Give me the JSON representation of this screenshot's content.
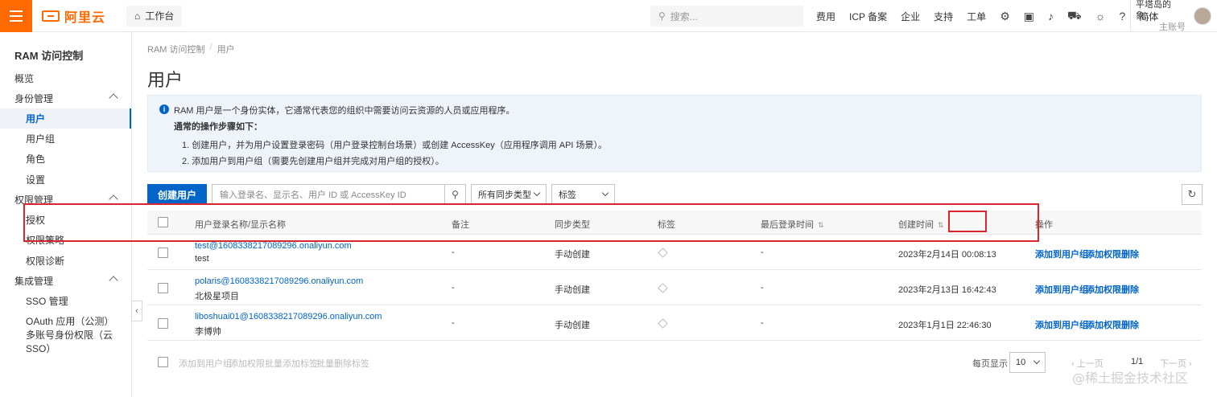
{
  "topbar": {
    "logo_text": "阿里云",
    "workbench": "工作台",
    "search_placeholder": "搜索...",
    "links": [
      "费用",
      "ICP 备案",
      "企业",
      "支持",
      "工单"
    ],
    "lang": "简体",
    "user_name": "平塔岛的象...",
    "user_sub": "主账号",
    "brand_color": "#ff6a00"
  },
  "sidebar": {
    "title": "RAM 访问控制",
    "items": [
      {
        "label": "概览"
      },
      {
        "label": "身份管理"
      },
      {
        "label": "用户"
      },
      {
        "label": "用户组"
      },
      {
        "label": "角色"
      },
      {
        "label": "设置"
      },
      {
        "label": "权限管理"
      },
      {
        "label": "授权"
      },
      {
        "label": "权限策略"
      },
      {
        "label": "权限诊断"
      },
      {
        "label": "集成管理"
      },
      {
        "label": "SSO 管理"
      },
      {
        "label": "OAuth 应用（公测）"
      },
      {
        "label": "多账号身份权限（云 SSO）"
      }
    ]
  },
  "breadcrumb": {
    "root": "RAM 访问控制",
    "sep": "/",
    "current": "用户"
  },
  "page_title": "用户",
  "notice": {
    "line1": "RAM 用户是一个身份实体，它通常代表您的组织中需要访问云资源的人员或应用程序。",
    "line2": "通常的操作步骤如下：",
    "line3": "1. 创建用户，并为用户设置登录密码（用户登录控制台场景）或创建 AccessKey（应用程序调用 API 场景）。",
    "line4": "2. 添加用户到用户组（需要先创建用户组并完成对用户组的授权）。"
  },
  "toolbar": {
    "create_label": "创建用户",
    "search_placeholder": "输入登录名、显示名、用户 ID 或 AccessKey ID",
    "sync_filter": "所有同步类型",
    "tag_filter": "标签"
  },
  "table": {
    "headers": {
      "name": "用户登录名称/显示名称",
      "remark": "备注",
      "sync": "同步类型",
      "tags": "标签",
      "last_login": "最后登录时间",
      "created": "创建时间",
      "actions": "操作"
    },
    "rows": [
      {
        "login": "test@1608338217089296.onaliyun.com",
        "display": "test",
        "remark": "-",
        "sync": "手动创建",
        "last_login": "-",
        "created": "2023年2月14日 00:08:13"
      },
      {
        "login": "polaris@1608338217089296.onaliyun.com",
        "display": "北极星项目",
        "remark": "-",
        "sync": "手动创建",
        "last_login": "-",
        "created": "2023年2月13日 16:42:43"
      },
      {
        "login": "liboshuai01@1608338217089296.onaliyun.com",
        "display": "李博帅",
        "remark": "-",
        "sync": "手动创建",
        "last_login": "-",
        "created": "2023年1月1日 22:46:30"
      }
    ],
    "actions": {
      "add_group": "添加到用户组",
      "add_perm": "添加权限",
      "delete": "删除"
    }
  },
  "footer": {
    "bulk_add_group": "添加到用户组",
    "bulk_add_perm": "添加权限",
    "bulk_add_tag": "批量添加标签",
    "bulk_del_tag": "批量删除标签",
    "per_page_label": "每页显示",
    "per_page": "10",
    "prev": "上一页",
    "page": "1/1",
    "next": "下一页"
  },
  "watermark": "@稀土掘金技术社区"
}
